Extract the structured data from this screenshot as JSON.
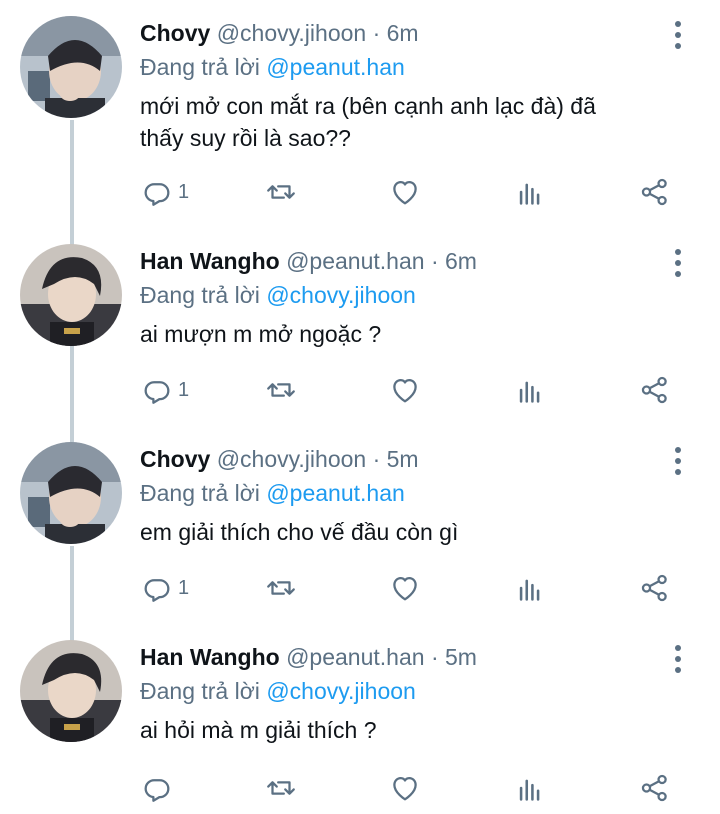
{
  "tweets": [
    {
      "name": "Chovy",
      "handle": "@chovy.jihoon",
      "time": "6m",
      "reply_prefix": "Đang trả lời",
      "reply_to": "@peanut.han",
      "text_lines": [
        "mới mở con mắt ra (bên cạnh anh lạc đà) đã",
        "thấy suy rồi là sao??"
      ],
      "reply_count": "1",
      "avatar": "chovy-avatar"
    },
    {
      "name": "Han Wangho",
      "handle": "@peanut.han",
      "time": "6m",
      "reply_prefix": "Đang trả lời",
      "reply_to": "@chovy.jihoon",
      "text_lines": [
        "ai mượn m mở ngoặc ?"
      ],
      "reply_count": "1",
      "avatar": "peanut-avatar"
    },
    {
      "name": "Chovy",
      "handle": "@chovy.jihoon",
      "time": "5m",
      "reply_prefix": "Đang trả lời",
      "reply_to": "@peanut.han",
      "text_lines": [
        "em giải thích cho vế đầu còn gì"
      ],
      "reply_count": "1",
      "avatar": "chovy-avatar"
    },
    {
      "name": "Han Wangho",
      "handle": "@peanut.han",
      "time": "5m",
      "reply_prefix": "Đang trả lời",
      "reply_to": "@chovy.jihoon",
      "text_lines": [
        "ai hỏi mà m giải thích ?"
      ],
      "reply_count": "",
      "avatar": "peanut-avatar"
    }
  ],
  "separator": "·",
  "icons": {
    "reply": "reply-icon",
    "retweet": "retweet-icon",
    "like": "heart-icon",
    "views": "analytics-icon",
    "share": "share-icon",
    "more": "more-icon"
  },
  "colors": {
    "link": "#1d9bf0",
    "secondary": "#5b7083",
    "thread_line": "#c4cfd6"
  }
}
